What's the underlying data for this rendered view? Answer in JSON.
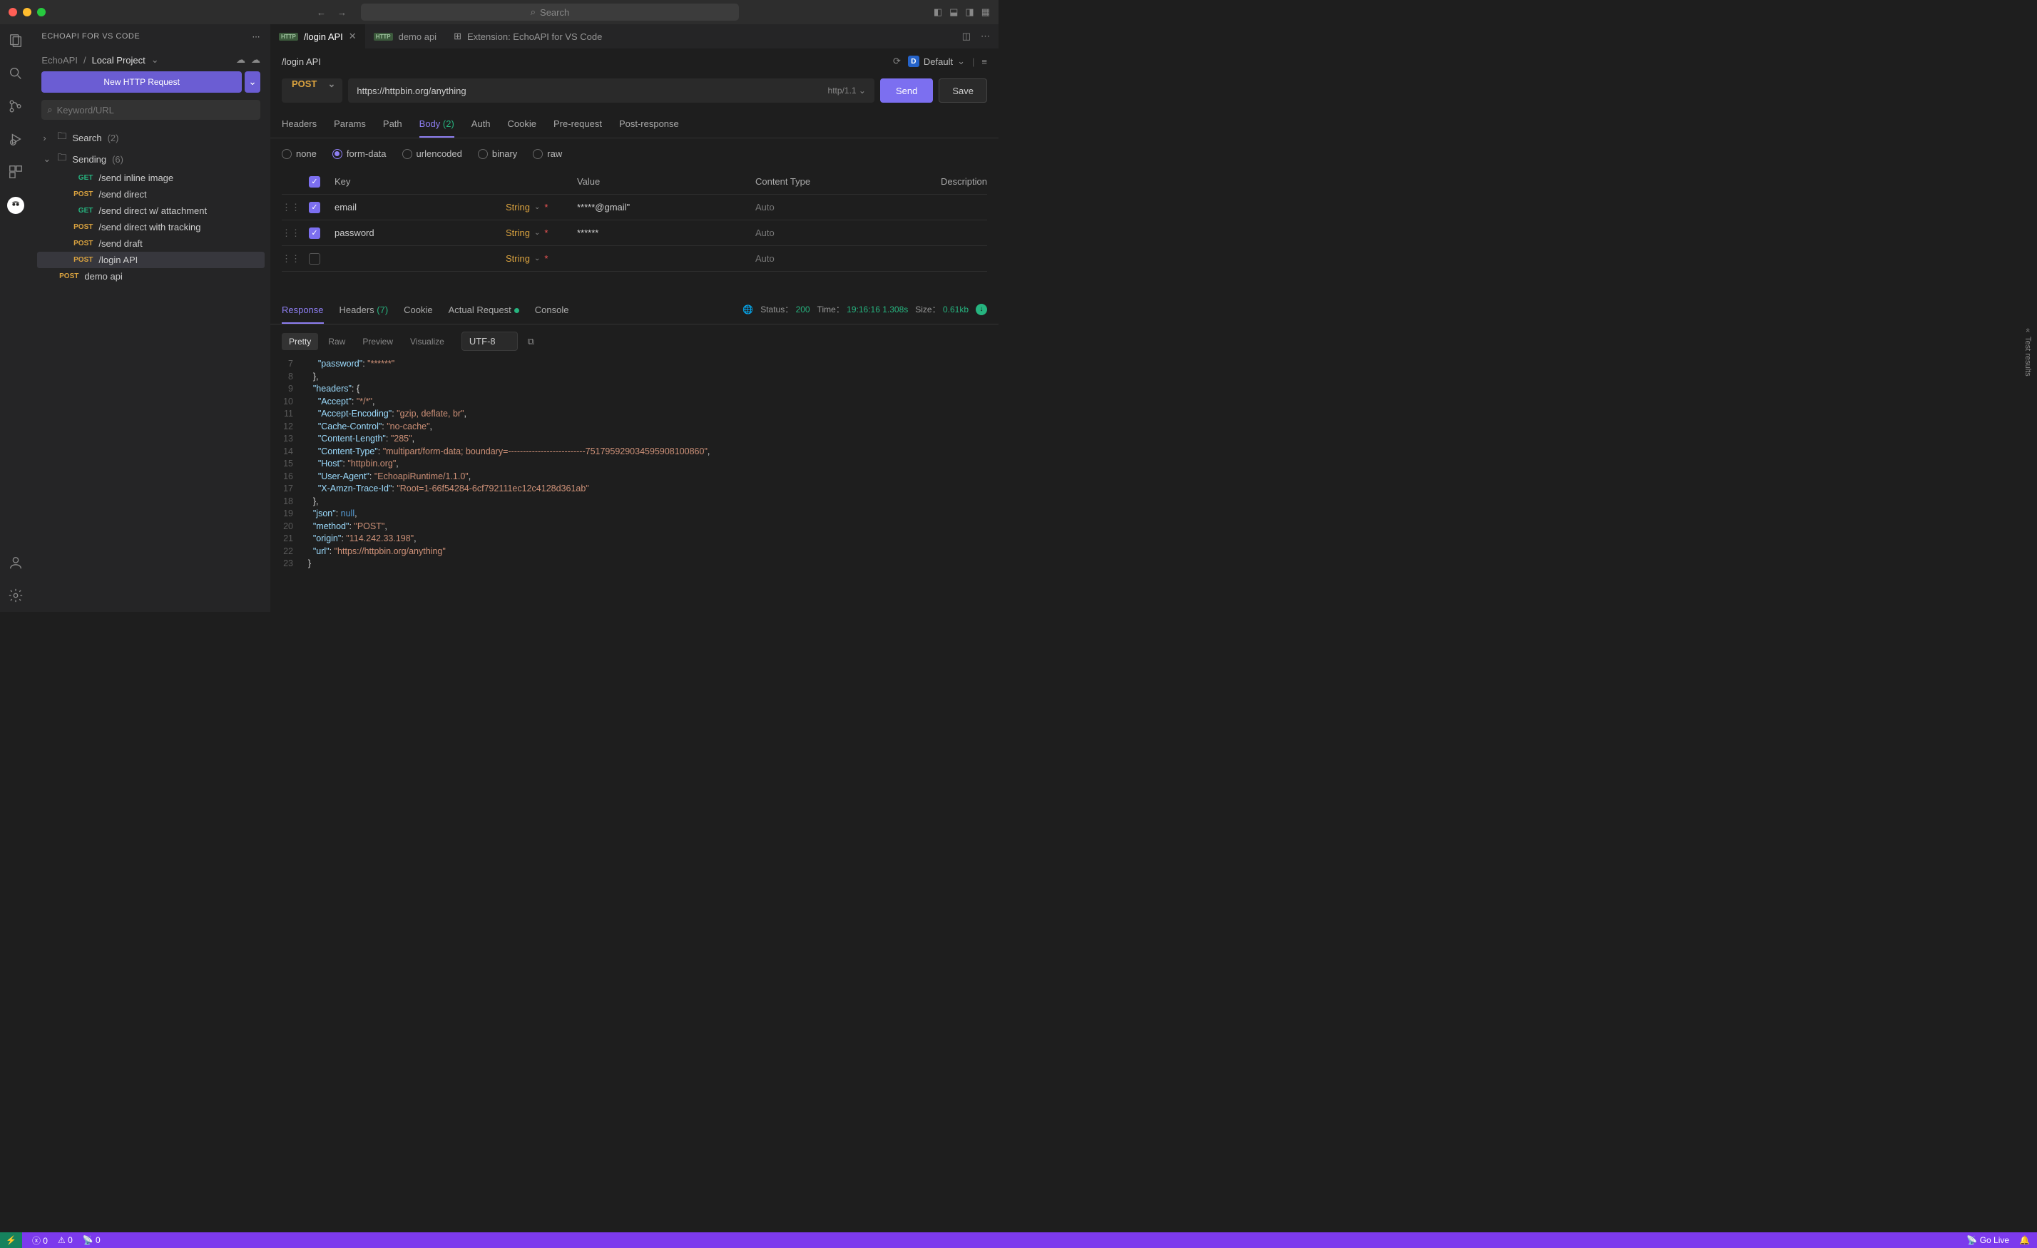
{
  "titlebar": {
    "search": "Search"
  },
  "sidebar": {
    "title": "ECHOAPI FOR VS CODE",
    "breadcrumb": {
      "root": "EchoAPI",
      "project": "Local Project"
    },
    "newButton": "New HTTP Request",
    "filterPlaceholder": "Keyword/URL",
    "folders": [
      {
        "name": "Search",
        "count": "(2)"
      },
      {
        "name": "Sending",
        "count": "(6)"
      }
    ],
    "requests": [
      {
        "method": "GET",
        "name": "/send inline image"
      },
      {
        "method": "POST",
        "name": "/send direct"
      },
      {
        "method": "GET",
        "name": "/send direct w/ attachment"
      },
      {
        "method": "POST",
        "name": "/send direct with tracking"
      },
      {
        "method": "POST",
        "name": "/send draft"
      },
      {
        "method": "POST",
        "name": "/login API"
      }
    ],
    "rootRequest": {
      "method": "POST",
      "name": "demo api"
    }
  },
  "tabs": [
    {
      "label": "/login API",
      "badge": "HTTP",
      "active": true,
      "close": true
    },
    {
      "label": "demo api",
      "badge": "HTTP"
    },
    {
      "label": "Extension: EchoAPI for VS Code",
      "ext": true
    }
  ],
  "env": {
    "label": "Default"
  },
  "path": "/login API",
  "request": {
    "method": "POST",
    "url": "https://httpbin.org/anything",
    "proto": "http/1.1",
    "send": "Send",
    "save": "Save",
    "reqTabs": [
      "Headers",
      "Params",
      "Path",
      "Body",
      "Auth",
      "Cookie",
      "Pre-request",
      "Post-response"
    ],
    "bodyBadge": "(2)",
    "bodyTypes": [
      "none",
      "form-data",
      "urlencoded",
      "binary",
      "raw"
    ],
    "formHead": {
      "key": "Key",
      "value": "Value",
      "ct": "Content Type",
      "desc": "Description"
    },
    "rows": [
      {
        "checked": true,
        "key": "email",
        "type": "String",
        "value": "*****@gmail\"",
        "ct": "Auto"
      },
      {
        "checked": true,
        "key": "password",
        "type": "String",
        "value": "******",
        "ct": "Auto"
      },
      {
        "checked": false,
        "key": "",
        "type": "String",
        "value": "",
        "ct": "Auto"
      }
    ]
  },
  "response": {
    "tabs": [
      "Response",
      "Headers",
      "Cookie",
      "Actual Request",
      "Console"
    ],
    "headerCount": "(7)",
    "status": {
      "label": "Status：",
      "code": "200",
      "timeLabel": "Time：",
      "time": "19:16:16",
      "dur": "1.308s",
      "sizeLabel": "Size：",
      "size": "0.61kb"
    },
    "views": [
      "Pretty",
      "Raw",
      "Preview",
      "Visualize"
    ],
    "encoding": "UTF-8",
    "lines": [
      {
        "n": 7,
        "indent": 3,
        "tokens": [
          [
            "k",
            "\"password\""
          ],
          [
            "p",
            ": "
          ],
          [
            "s",
            "\"******\""
          ]
        ]
      },
      {
        "n": 8,
        "indent": 2,
        "tokens": [
          [
            "p",
            "},"
          ]
        ]
      },
      {
        "n": 9,
        "indent": 2,
        "tokens": [
          [
            "k",
            "\"headers\""
          ],
          [
            "p",
            ": {"
          ]
        ]
      },
      {
        "n": 10,
        "indent": 3,
        "tokens": [
          [
            "k",
            "\"Accept\""
          ],
          [
            "p",
            ": "
          ],
          [
            "s",
            "\"*/*\""
          ],
          [
            "p",
            ","
          ]
        ]
      },
      {
        "n": 11,
        "indent": 3,
        "tokens": [
          [
            "k",
            "\"Accept-Encoding\""
          ],
          [
            "p",
            ": "
          ],
          [
            "s",
            "\"gzip, deflate, br\""
          ],
          [
            "p",
            ","
          ]
        ]
      },
      {
        "n": 12,
        "indent": 3,
        "tokens": [
          [
            "k",
            "\"Cache-Control\""
          ],
          [
            "p",
            ": "
          ],
          [
            "s",
            "\"no-cache\""
          ],
          [
            "p",
            ","
          ]
        ]
      },
      {
        "n": 13,
        "indent": 3,
        "tokens": [
          [
            "k",
            "\"Content-Length\""
          ],
          [
            "p",
            ": "
          ],
          [
            "s",
            "\"285\""
          ],
          [
            "p",
            ","
          ]
        ]
      },
      {
        "n": 14,
        "indent": 3,
        "tokens": [
          [
            "k",
            "\"Content-Type\""
          ],
          [
            "p",
            ": "
          ],
          [
            "s",
            "\"multipart/form-data; boundary=--------------------------751795929034595908100860\""
          ],
          [
            "p",
            ","
          ]
        ]
      },
      {
        "n": 15,
        "indent": 3,
        "tokens": [
          [
            "k",
            "\"Host\""
          ],
          [
            "p",
            ": "
          ],
          [
            "s",
            "\"httpbin.org\""
          ],
          [
            "p",
            ","
          ]
        ]
      },
      {
        "n": 16,
        "indent": 3,
        "tokens": [
          [
            "k",
            "\"User-Agent\""
          ],
          [
            "p",
            ": "
          ],
          [
            "s",
            "\"EchoapiRuntime/1.1.0\""
          ],
          [
            "p",
            ","
          ]
        ]
      },
      {
        "n": 17,
        "indent": 3,
        "tokens": [
          [
            "k",
            "\"X-Amzn-Trace-Id\""
          ],
          [
            "p",
            ": "
          ],
          [
            "s",
            "\"Root=1-66f54284-6cf792111ec12c4128d361ab\""
          ]
        ]
      },
      {
        "n": 18,
        "indent": 2,
        "tokens": [
          [
            "p",
            "},"
          ]
        ]
      },
      {
        "n": 19,
        "indent": 2,
        "tokens": [
          [
            "k",
            "\"json\""
          ],
          [
            "p",
            ": "
          ],
          [
            "n",
            "null"
          ],
          [
            "p",
            ","
          ]
        ]
      },
      {
        "n": 20,
        "indent": 2,
        "tokens": [
          [
            "k",
            "\"method\""
          ],
          [
            "p",
            ": "
          ],
          [
            "s",
            "\"POST\""
          ],
          [
            "p",
            ","
          ]
        ]
      },
      {
        "n": 21,
        "indent": 2,
        "tokens": [
          [
            "k",
            "\"origin\""
          ],
          [
            "p",
            ": "
          ],
          [
            "s",
            "\"114.242.33.198\""
          ],
          [
            "p",
            ","
          ]
        ]
      },
      {
        "n": 22,
        "indent": 2,
        "tokens": [
          [
            "k",
            "\"url\""
          ],
          [
            "p",
            ": "
          ],
          [
            "s",
            "\"https://httpbin.org/anything\""
          ]
        ]
      },
      {
        "n": 23,
        "indent": 1,
        "tokens": [
          [
            "p",
            "}"
          ]
        ]
      }
    ]
  },
  "rightRail": "Test results",
  "statusbar": {
    "errors": "0",
    "warnings": "0",
    "ports": "0",
    "golive": "Go Live"
  }
}
